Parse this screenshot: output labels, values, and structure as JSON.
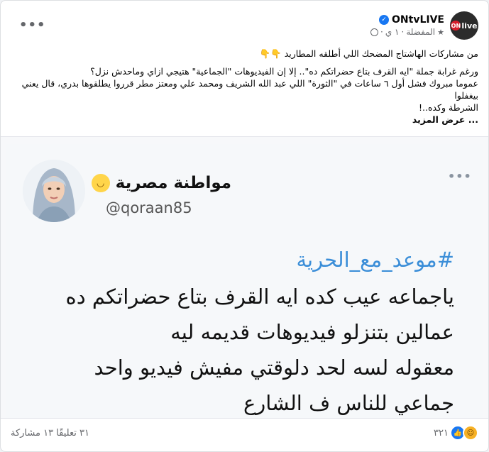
{
  "post": {
    "page_name": "ONtvLIVE",
    "avatar_on": "ON",
    "avatar_live": "live",
    "meta_time": "١ ي",
    "meta_sep": "·",
    "meta_fav": "المفضلة",
    "more_dots": "•••",
    "text_lines": [
      "من مشاركات الهاشتاج المضحك اللي أطلقه المطاريد 👇👇",
      "ورغم غرابة جملة \"ايه القرف بتاع حضراتكم ده\".. إلا إن الفيديوهات \"الجماعية\" هتيجي ازاي وماحدش نزل؟",
      "عموما مبروك فشل أول ٦ ساعات في \"الثورة\" اللي عبد الله الشريف ومحمد علي ومعتز مطر قرروا يطلقوها بدري، قال يعني بيغفلوا",
      "الشرطة وكده..!"
    ],
    "see_more": "... عرض المزيد"
  },
  "tweet": {
    "display_name": "مواطنة مصرية",
    "handle": "@qoraan85",
    "dots": "•••",
    "hashtag": "#موعد_مع_الحرية",
    "body_lines": [
      "ياجماعه عيب كده ايه القرف بتاع حضراتكم ده",
      "عمالين بتنزلو فيديوهات قديمه ليه",
      "معقوله لسه لحد دلوقتي مفيش فيديو واحد",
      "جماعي للناس ف الشارع"
    ]
  },
  "footer": {
    "reactions_count": "٣٢١",
    "comments_shares": "٣١ تعليقًا  ١٣ مشاركة"
  },
  "colors": {
    "accent": "#1877f2",
    "hashtag": "#3b8ed8",
    "brand_red": "#d81e2b"
  }
}
